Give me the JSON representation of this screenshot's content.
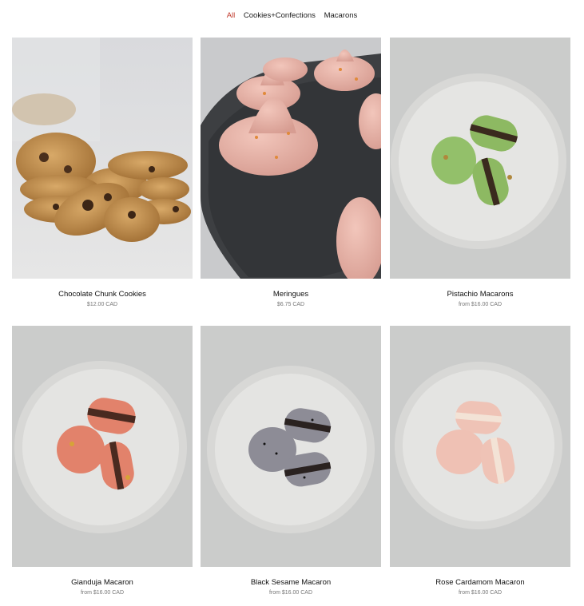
{
  "filters": [
    {
      "label": "All",
      "active": true
    },
    {
      "label": "Cookies+Confections",
      "active": false
    },
    {
      "label": "Macarons",
      "active": false
    }
  ],
  "products": [
    {
      "name": "Chocolate Chunk Cookies",
      "price": "$12.00 CAD"
    },
    {
      "name": "Meringues",
      "price": "$6.75 CAD"
    },
    {
      "name": "Pistachio Macarons",
      "price": "from $16.00 CAD"
    },
    {
      "name": "Gianduja Macaron",
      "price": "from $16.00 CAD"
    },
    {
      "name": "Black Sesame Macaron",
      "price": "from $16.00 CAD"
    },
    {
      "name": "Rose Cardamom Macaron",
      "price": "from $16.00 CAD"
    }
  ],
  "colors": {
    "active_filter": "#c0392b",
    "price_text": "#777777"
  }
}
